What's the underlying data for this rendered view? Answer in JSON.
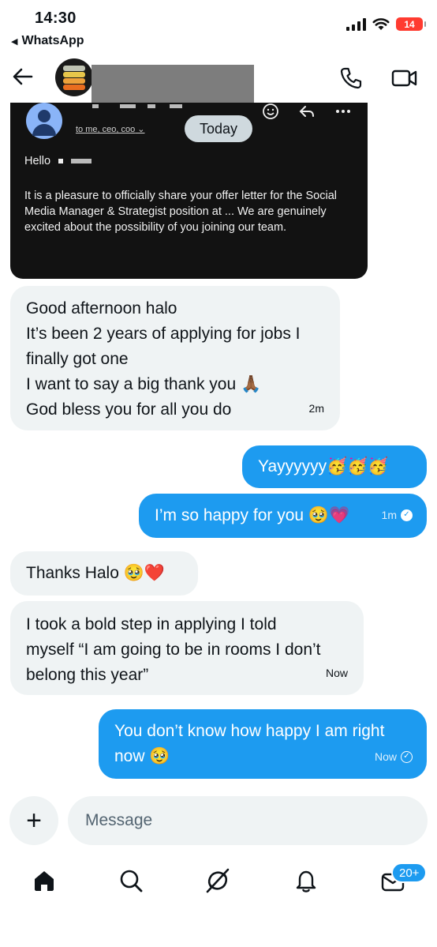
{
  "status_bar": {
    "time": "14:30",
    "back_app_label": "WhatsApp",
    "battery_level": "14",
    "battery_color": "#ff3b30"
  },
  "header": {
    "back_icon": "arrow-left-icon",
    "call_icon": "phone-icon",
    "video_icon": "video-camera-icon"
  },
  "email_screenshot": {
    "recipients": "to me, ceo, coo",
    "greeting": "Hello",
    "body": "It is a pleasure to officially share your offer letter for the Social Media Manager & Strategist position at ... We are genuinely excited about the possibility of you joining our team."
  },
  "date_pill": "Today",
  "messages": [
    {
      "direction": "incoming",
      "lines": [
        "Good afternoon halo",
        "It’s been 2 years of applying for jobs I",
        "finally got one",
        "I want to say a big thank you 🙏🏾",
        "God bless you for all you do"
      ],
      "time": "2m"
    },
    {
      "direction": "outgoing",
      "text": "Yayyyyyy🥳🥳🥳",
      "time": ""
    },
    {
      "direction": "outgoing",
      "text": "I’m so happy for you 🥹💗",
      "time": "1m",
      "status": "read"
    },
    {
      "direction": "incoming",
      "text": "Thanks Halo 🥹❤️",
      "time": ""
    },
    {
      "direction": "incoming",
      "lines": [
        "I took a bold step in applying I told",
        "myself “I am going to be in rooms I don’t",
        "belong this year”"
      ],
      "time": "Now"
    },
    {
      "direction": "outgoing",
      "lines": [
        "You don’t know how happy I am right",
        "now 🥹"
      ],
      "time": "Now",
      "status": "sent"
    }
  ],
  "composer": {
    "placeholder": "Message",
    "add_icon": "plus-icon"
  },
  "tab_bar": {
    "items": [
      "home-icon",
      "search-icon",
      "grok-icon",
      "notifications-icon",
      "messages-icon"
    ],
    "messages_badge": "20+"
  },
  "colors": {
    "accent": "#1d9bf0",
    "incoming_bubble": "#eff3f4",
    "text": "#0f1419"
  }
}
